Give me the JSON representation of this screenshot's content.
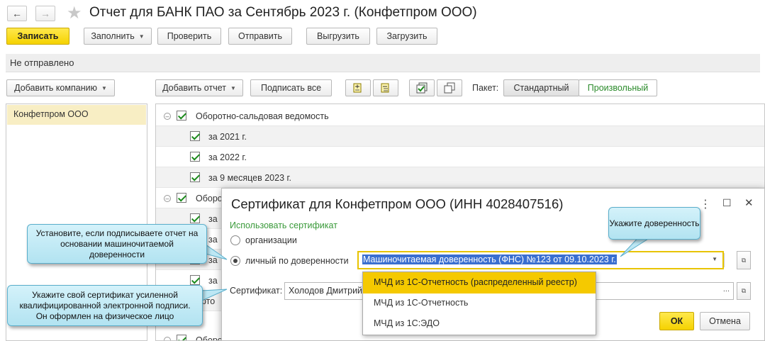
{
  "window": {
    "title": "Отчет для БАНК ПАО за Сентябрь 2023 г. (Конфетпром ООО)",
    "back_icon": "←",
    "forward_icon": "→",
    "star_icon": "★"
  },
  "toolbar": {
    "save": "Записать",
    "fill": "Заполнить",
    "check": "Проверить",
    "send": "Отправить",
    "export": "Выгрузить",
    "import": "Загрузить"
  },
  "status": "Не отправлено",
  "left_panel": {
    "add_company": "Добавить компанию",
    "companies": [
      "Конфетпром ООО"
    ]
  },
  "grid_toolbar": {
    "add_report": "Добавить отчет",
    "sign_all": "Подписать все",
    "package_label": "Пакет:",
    "package_standard": "Стандартный",
    "package_custom": "Произвольный"
  },
  "grid": {
    "group1": "Оборотно-сальдовая ведомость",
    "items1": [
      "за 2021 г.",
      "за 2022 г.",
      "за 9 месяцев 2023 г."
    ],
    "group2_partial": "Оборо",
    "partial_rows": [
      "за",
      "за",
      "за",
      "за",
      "рто"
    ],
    "last_partial": "Оборотно-сальдовая вед"
  },
  "dialog": {
    "title": "Сертификат для Конфетпром ООО (ИНН 4028407516)",
    "use_cert_label": "Использовать сертификат",
    "option_org": "организации",
    "option_personal": "личный по доверенности",
    "poa_value": "Машиночитаемая доверенность (ФНС) №123 от 09.10.2023 г.",
    "cert_label": "Сертификат:",
    "cert_value": "Холодов Дмитрий",
    "ok": "ОК",
    "cancel": "Отмена",
    "menu_icon": "⋮",
    "maximize_icon": "☐",
    "close_icon": "✕",
    "dropdown_options": [
      "МЧД из 1С-Отчетность (распределенный реестр)",
      "МЧД из 1С-Отчетность",
      "МЧД из 1С:ЭДО"
    ]
  },
  "callouts": {
    "poa": "Укажите доверенность",
    "personal": "Установите, если подписываете отчет на основании машиночитаемой доверенности",
    "certificate": "Укажите свой сертификат усиленной квалифицированной электронной подписи. Он оформлен на физическое лицо"
  }
}
